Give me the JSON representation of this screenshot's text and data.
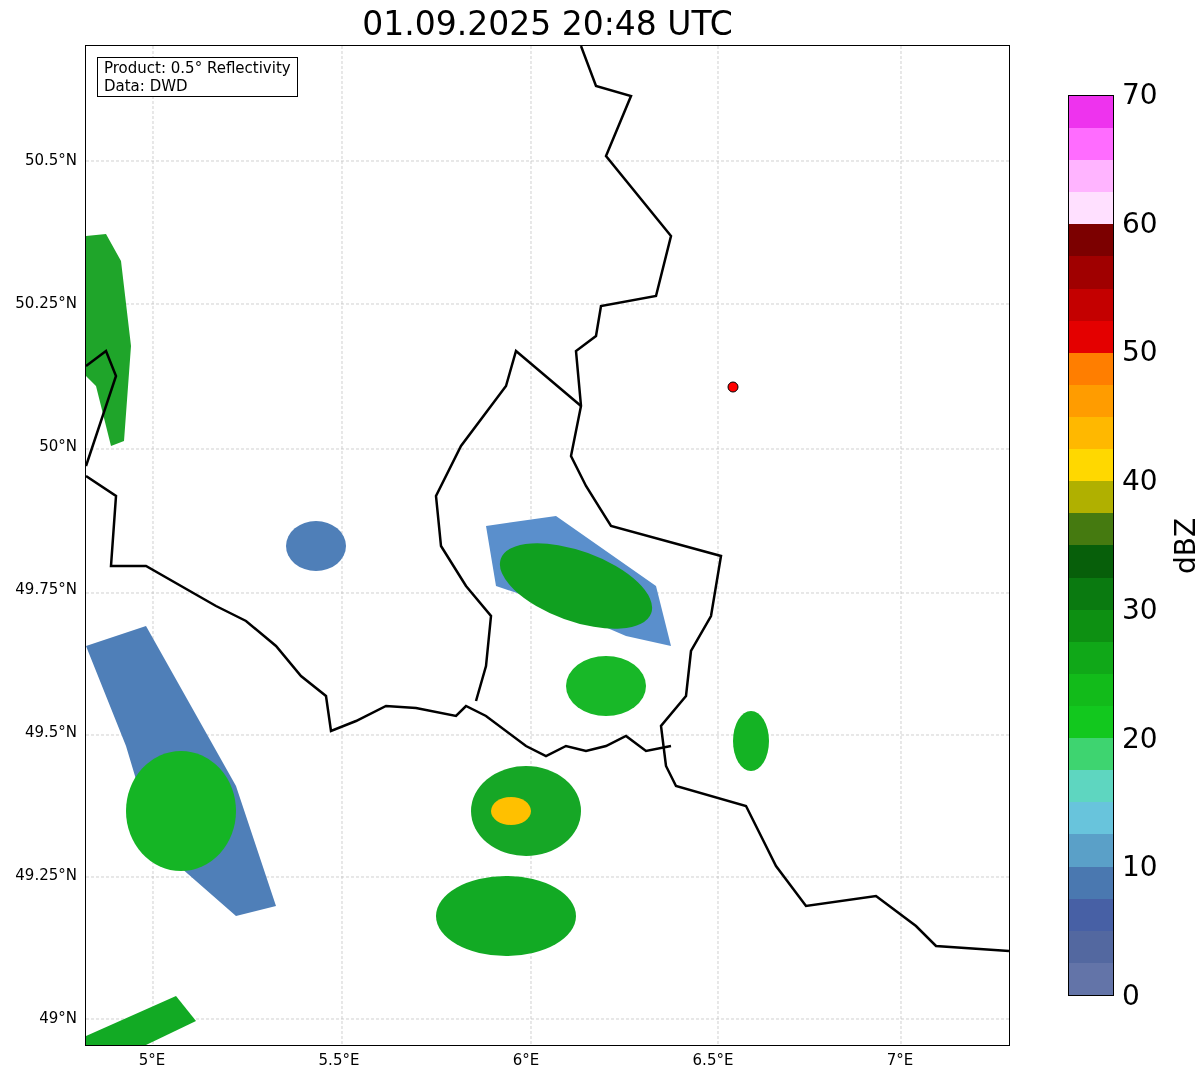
{
  "title": "01.09.2025 20:48 UTC",
  "info_box": [
    "Product: 0.5° Reflectivity",
    "Data: DWD"
  ],
  "y_ticks": [
    "50.5°N",
    "50.25°N",
    "50°N",
    "49.75°N",
    "49.5°N",
    "49.25°N",
    "49°N"
  ],
  "x_ticks": [
    "5°E",
    "5.5°E",
    "6°E",
    "6.5°E",
    "7°E"
  ],
  "colorbar": {
    "label": "dBZ",
    "ticks": [
      "70",
      "60",
      "50",
      "40",
      "30",
      "20",
      "10",
      "0"
    ]
  }
}
